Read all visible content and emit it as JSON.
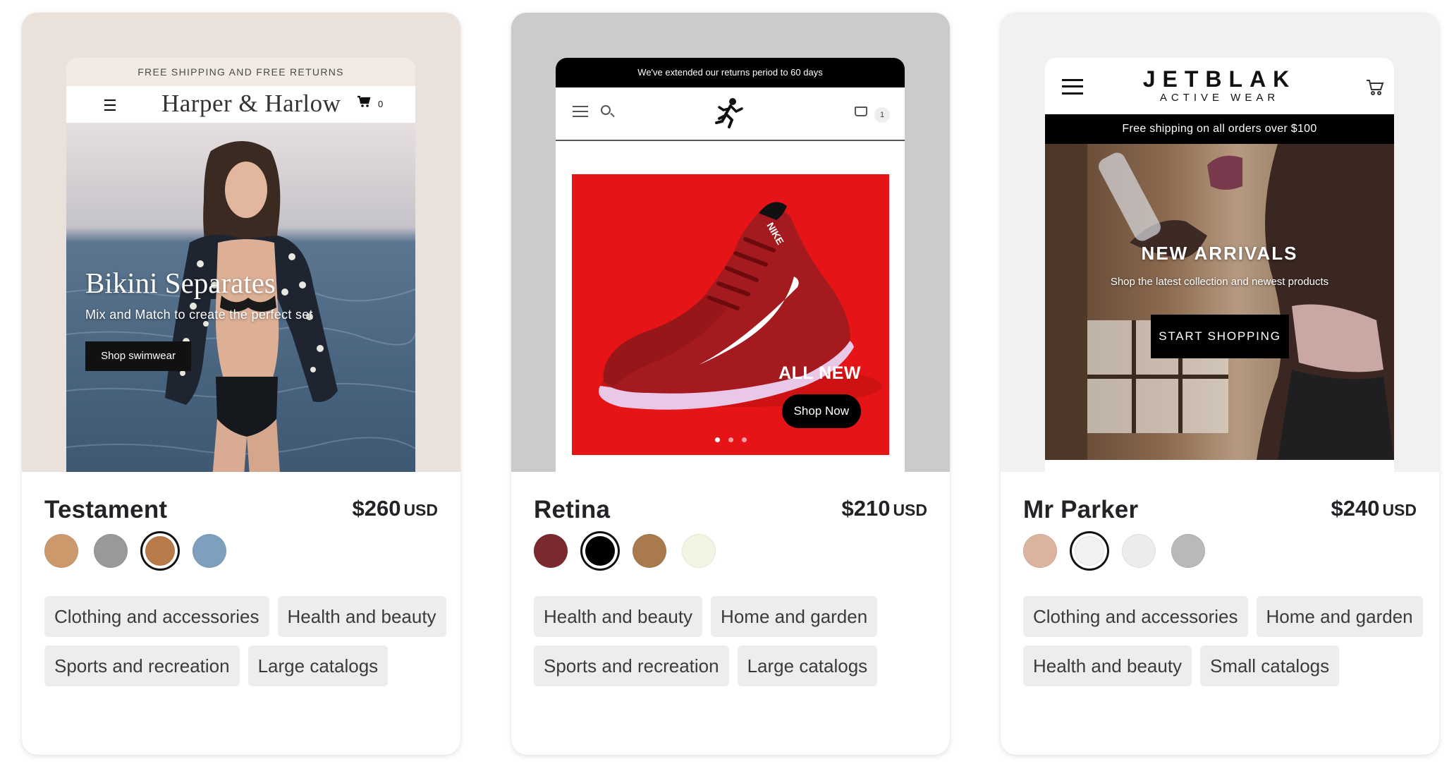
{
  "themes": [
    {
      "name": "Testament",
      "price": "$260",
      "currency": "USD",
      "preview_bg": "#e9e1da",
      "swatches": [
        {
          "color": "#cc996d",
          "selected": false
        },
        {
          "color": "#999999",
          "selected": false
        },
        {
          "color": "#b97a4a",
          "selected": true
        },
        {
          "color": "#7e9fbd",
          "selected": false
        }
      ],
      "tags": [
        "Clothing and accessories",
        "Health and beauty",
        "Sports and recreation",
        "Large catalogs"
      ],
      "preview": {
        "announcement": "FREE SHIPPING AND FREE RETURNS",
        "logo": "Harper & Harlow",
        "cart_count": "0",
        "hero_title": "Bikini Separates",
        "hero_subtitle": "Mix and Match to create the perfect set",
        "hero_button": "Shop swimwear"
      }
    },
    {
      "name": "Retina",
      "price": "$210",
      "currency": "USD",
      "preview_bg": "#cbcbcc",
      "swatches": [
        {
          "color": "#7a2a2f",
          "selected": false
        },
        {
          "color": "#000000",
          "selected": true
        },
        {
          "color": "#a87a4e",
          "selected": false
        },
        {
          "color": "#f3f4e3",
          "selected": false
        }
      ],
      "tags": [
        "Health and beauty",
        "Home and garden",
        "Sports and recreation",
        "Large catalogs"
      ],
      "preview": {
        "announcement": "We've extended our returns period to 60 days",
        "cart_count": "1",
        "hero_headline": "ALL NEW",
        "hero_button": "Shop Now",
        "brand_on_shoe": "NIKE"
      }
    },
    {
      "name": "Mr Parker",
      "price": "$240",
      "currency": "USD",
      "preview_bg": "#f1f1f1",
      "swatches": [
        {
          "color": "#dcb39e",
          "selected": false
        },
        {
          "color": "#f2f2f2",
          "selected": true
        },
        {
          "color": "#ececec",
          "selected": false
        },
        {
          "color": "#b9b9b9",
          "selected": false
        }
      ],
      "tags": [
        "Clothing and accessories",
        "Home and garden",
        "Health and beauty",
        "Small catalogs"
      ],
      "preview": {
        "logo": "JETBLAK",
        "logo_sub": "ACTIVE WEAR",
        "announcement": "Free shipping on all orders over $100",
        "hero_title": "NEW ARRIVALS",
        "hero_subtitle": "Shop the latest collection and newest products",
        "hero_button": "START SHOPPING"
      }
    }
  ]
}
